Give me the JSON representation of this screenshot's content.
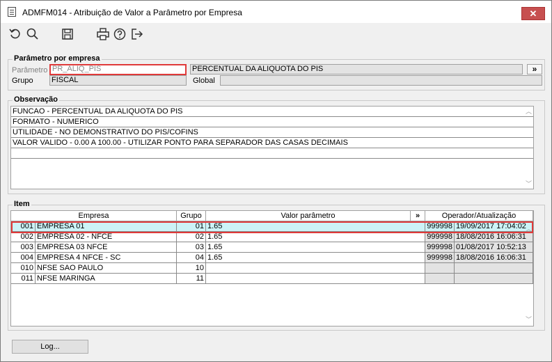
{
  "window": {
    "title": "ADMFM014 - Atribuição de Valor a Parâmetro por Empresa",
    "close_label": "✕"
  },
  "toolbar": {
    "icons": [
      "refresh-icon",
      "search-icon",
      "save-icon",
      "print-icon",
      "help-icon",
      "exit-icon"
    ]
  },
  "parametro_group": {
    "legend": "Parâmetro por empresa",
    "parametro_label": "Parâmetro",
    "parametro_value": "PR_ALIQ_PIS",
    "parametro_desc": "PERCENTUAL DA ALIQUOTA DO PIS",
    "expand_label": "»",
    "grupo_label": "Grupo",
    "grupo_value": "FISCAL",
    "global_label": "Global",
    "global_value": ""
  },
  "observacao": {
    "legend": "Observação",
    "lines": [
      "FUNCAO - PERCENTUAL DA ALIQUOTA DO PIS",
      "FORMATO - NUMERICO",
      "UTILIDADE - NO DEMONSTRATIVO DO PIS/COFINS",
      "VALOR VALIDO - 0.00 A 100.00 - UTILIZAR PONTO PARA SEPARADOR DAS CASAS DECIMAIS",
      ""
    ]
  },
  "item": {
    "legend": "Item",
    "columns": {
      "empresa": "Empresa",
      "grupo": "Grupo",
      "valor": "Valor parâmetro",
      "expand": "»",
      "operador": "Operador/Atualização"
    },
    "rows": [
      {
        "code": "001",
        "name": "EMPRESA 01",
        "grupo": "01",
        "valor": "1.65",
        "operador": "999998",
        "data": "19/09/2017 17:04:02"
      },
      {
        "code": "002",
        "name": "EMPRESA 02 - NFCE",
        "grupo": "02",
        "valor": "1.65",
        "operador": "999998",
        "data": "18/08/2016 16:06:31"
      },
      {
        "code": "003",
        "name": "EMPRESA 03 NFCE",
        "grupo": "03",
        "valor": "1.65",
        "operador": "999998",
        "data": "01/08/2017 10:52:13"
      },
      {
        "code": "004",
        "name": "EMPRESA 4 NFCE - SC",
        "grupo": "04",
        "valor": "1.65",
        "operador": "999998",
        "data": "18/08/2016 16:06:31"
      },
      {
        "code": "010",
        "name": "NFSE SAO PAULO",
        "grupo": "10",
        "valor": "",
        "operador": "",
        "data": ""
      },
      {
        "code": "011",
        "name": "NFSE MARINGA",
        "grupo": "11",
        "valor": "",
        "operador": "",
        "data": ""
      }
    ]
  },
  "footer": {
    "log_label": "Log..."
  }
}
